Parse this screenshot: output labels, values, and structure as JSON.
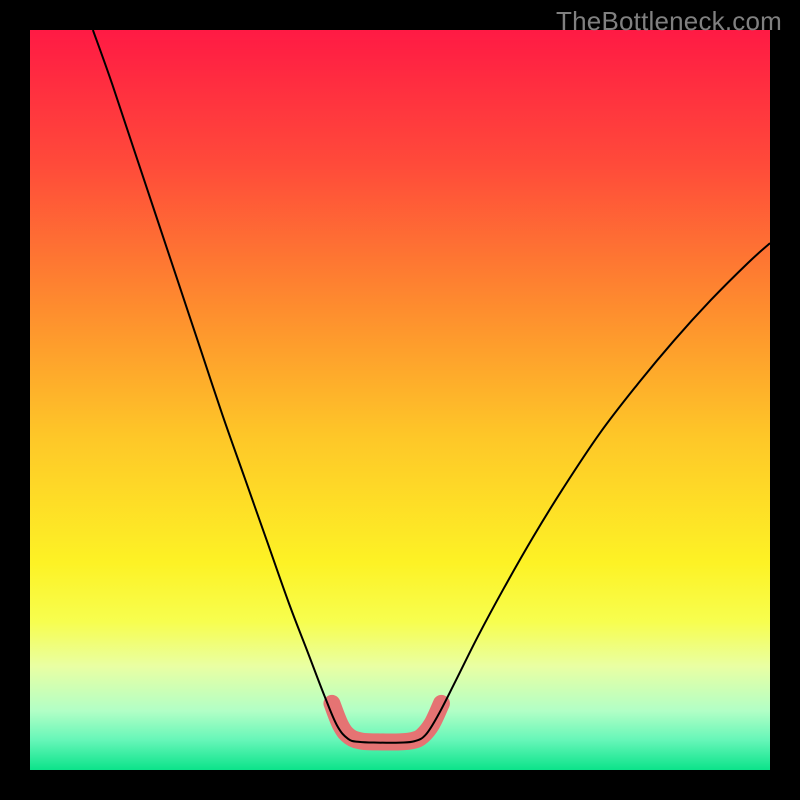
{
  "watermark": "TheBottleneck.com",
  "chart_data": {
    "type": "line",
    "title": "",
    "xlabel": "",
    "ylabel": "",
    "xlim": [
      0,
      1
    ],
    "ylim": [
      0,
      1
    ],
    "background_gradient": {
      "stops": [
        {
          "offset": 0.0,
          "color": "#ff1a44"
        },
        {
          "offset": 0.18,
          "color": "#ff4a3a"
        },
        {
          "offset": 0.38,
          "color": "#fe8e2e"
        },
        {
          "offset": 0.55,
          "color": "#fec728"
        },
        {
          "offset": 0.72,
          "color": "#fdf225"
        },
        {
          "offset": 0.8,
          "color": "#f7fe4f"
        },
        {
          "offset": 0.86,
          "color": "#e9ffa3"
        },
        {
          "offset": 0.92,
          "color": "#b2ffc6"
        },
        {
          "offset": 0.96,
          "color": "#65f6b8"
        },
        {
          "offset": 1.0,
          "color": "#0be38a"
        }
      ]
    },
    "series": [
      {
        "name": "curve",
        "stroke": "#000000",
        "stroke_width": 2,
        "points": [
          {
            "x": 0.085,
            "y": 1.0
          },
          {
            "x": 0.11,
            "y": 0.93
          },
          {
            "x": 0.14,
            "y": 0.84
          },
          {
            "x": 0.17,
            "y": 0.75
          },
          {
            "x": 0.2,
            "y": 0.66
          },
          {
            "x": 0.23,
            "y": 0.57
          },
          {
            "x": 0.26,
            "y": 0.48
          },
          {
            "x": 0.29,
            "y": 0.395
          },
          {
            "x": 0.32,
            "y": 0.31
          },
          {
            "x": 0.35,
            "y": 0.225
          },
          {
            "x": 0.375,
            "y": 0.16
          },
          {
            "x": 0.398,
            "y": 0.1
          },
          {
            "x": 0.415,
            "y": 0.06
          },
          {
            "x": 0.43,
            "y": 0.042
          },
          {
            "x": 0.445,
            "y": 0.038
          },
          {
            "x": 0.47,
            "y": 0.037
          },
          {
            "x": 0.5,
            "y": 0.037
          },
          {
            "x": 0.52,
            "y": 0.039
          },
          {
            "x": 0.535,
            "y": 0.048
          },
          {
            "x": 0.552,
            "y": 0.075
          },
          {
            "x": 0.575,
            "y": 0.12
          },
          {
            "x": 0.605,
            "y": 0.18
          },
          {
            "x": 0.64,
            "y": 0.245
          },
          {
            "x": 0.68,
            "y": 0.315
          },
          {
            "x": 0.72,
            "y": 0.38
          },
          {
            "x": 0.77,
            "y": 0.455
          },
          {
            "x": 0.82,
            "y": 0.52
          },
          {
            "x": 0.87,
            "y": 0.58
          },
          {
            "x": 0.92,
            "y": 0.635
          },
          {
            "x": 0.97,
            "y": 0.685
          },
          {
            "x": 1.0,
            "y": 0.712
          }
        ]
      },
      {
        "name": "bottom-highlight",
        "stroke": "#e57373",
        "stroke_width": 17,
        "linecap": "round",
        "points": [
          {
            "x": 0.408,
            "y": 0.09
          },
          {
            "x": 0.42,
            "y": 0.06
          },
          {
            "x": 0.432,
            "y": 0.045
          },
          {
            "x": 0.448,
            "y": 0.039
          },
          {
            "x": 0.47,
            "y": 0.038
          },
          {
            "x": 0.5,
            "y": 0.038
          },
          {
            "x": 0.518,
            "y": 0.04
          },
          {
            "x": 0.53,
            "y": 0.046
          },
          {
            "x": 0.543,
            "y": 0.062
          },
          {
            "x": 0.556,
            "y": 0.09
          }
        ]
      }
    ]
  }
}
